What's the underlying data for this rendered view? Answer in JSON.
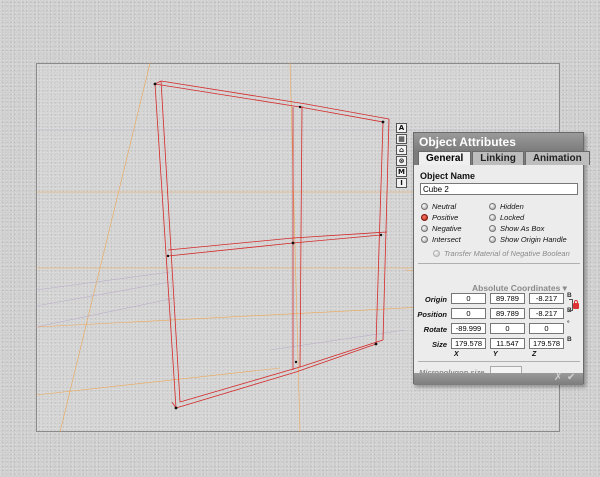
{
  "toolbar": {
    "tools": [
      {
        "label": "A",
        "icon": "align-icon"
      },
      {
        "label": "▦",
        "icon": "grid-icon"
      },
      {
        "label": "⌂",
        "icon": "home-icon"
      },
      {
        "label": "⊗",
        "icon": "target-icon"
      },
      {
        "label": "M",
        "icon": "material-icon"
      },
      {
        "label": "I",
        "icon": "info-icon"
      }
    ]
  },
  "panel": {
    "title": "Object Attributes",
    "tabs": [
      "General",
      "Linking",
      "Animation"
    ],
    "active_tab": "General",
    "object_name_label": "Object Name",
    "object_name_value": "Cube 2",
    "boolean_options": [
      {
        "label": "Neutral",
        "selected": false
      },
      {
        "label": "Positive",
        "selected": true
      },
      {
        "label": "Negative",
        "selected": false
      },
      {
        "label": "Intersect",
        "selected": false
      }
    ],
    "flag_options": [
      {
        "label": "Hidden",
        "checked": false
      },
      {
        "label": "Locked",
        "checked": false
      },
      {
        "label": "Show As Box",
        "checked": false
      },
      {
        "label": "Show Origin Handle",
        "checked": false
      }
    ],
    "transfer_label": "Transfer Material of Negative Boolean",
    "coordinates_header": "Absolute Coordinates ▾",
    "rows": [
      {
        "label": "Origin",
        "values": [
          "0",
          "89.789",
          "-8.217"
        ]
      },
      {
        "label": "Position",
        "values": [
          "0",
          "89.789",
          "-8.217"
        ]
      },
      {
        "label": "Rotate",
        "values": [
          "-89.999",
          "0",
          "0"
        ]
      },
      {
        "label": "Size",
        "values": [
          "179.578",
          "11.547",
          "179.578"
        ]
      }
    ],
    "link_letters": [
      "B",
      "B",
      "°",
      "B"
    ],
    "axis_labels": [
      "X",
      "Y",
      "Z"
    ],
    "micropolygon_label": "Micropolygon size",
    "micropolygon_value": "",
    "footer_icons": {
      "cancel": "✗",
      "ok": "✔"
    }
  },
  "colors": {
    "wire": "#d42a2a",
    "guide": "#f0a040",
    "panel_title": "#8a8a8a",
    "radio_selected": "#c0301f"
  }
}
